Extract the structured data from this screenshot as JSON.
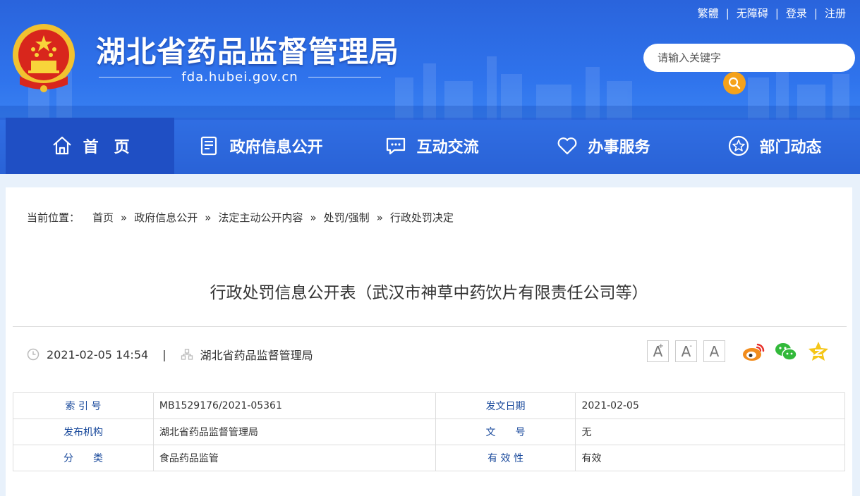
{
  "toplinks": [
    "繁體",
    "无障碍",
    "登录",
    "注册"
  ],
  "site": {
    "title": "湖北省药品监督管理局",
    "domain": "fda.hubei.gov.cn"
  },
  "search": {
    "placeholder": "请输入关键字"
  },
  "nav": [
    {
      "label": "首　页",
      "icon": "home-icon"
    },
    {
      "label": "政府信息公开",
      "icon": "document-icon"
    },
    {
      "label": "互动交流",
      "icon": "chat-icon"
    },
    {
      "label": "办事服务",
      "icon": "heart-icon"
    },
    {
      "label": "部门动态",
      "icon": "star-icon"
    }
  ],
  "breadcrumb": {
    "lead": "当前位置：",
    "items": [
      "首页",
      "政府信息公开",
      "法定主动公开内容",
      "处罚/强制",
      "行政处罚决定"
    ]
  },
  "article": {
    "title": "行政处罚信息公开表（武汉市神草中药饮片有限责任公司等）",
    "datetime": "2021-02-05 14:54",
    "source": "湖北省药品监督管理局"
  },
  "font_buttons": [
    "A",
    "A",
    "A"
  ],
  "info_table": [
    {
      "label1": "索 引 号",
      "value1": "MB1529176/2021-05361",
      "label2": "发文日期",
      "value2": "2021-02-05"
    },
    {
      "label1": "发布机构",
      "value1": "湖北省药品监督管理局",
      "label2": "文　　号",
      "value2": "无"
    },
    {
      "label1": "分　　类",
      "value1": "食品药品监管",
      "label2": "有 效 性",
      "value2": "有效"
    }
  ],
  "colors": {
    "header_blue": "#2f73ec",
    "nav_active": "#1f4fc4",
    "search_button": "#f5a21a",
    "table_label": "#1a4a9c"
  }
}
